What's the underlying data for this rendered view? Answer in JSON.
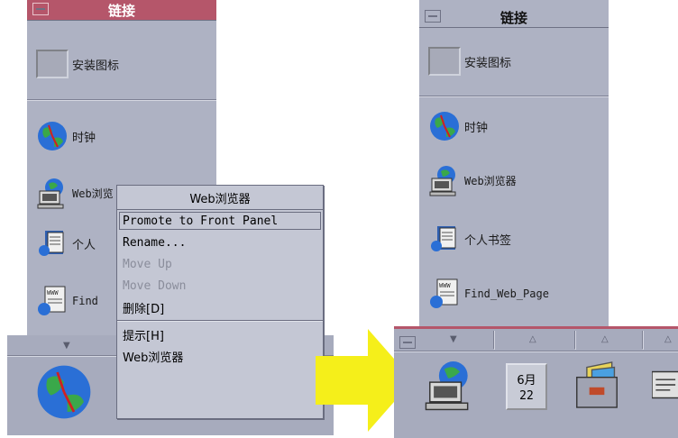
{
  "left": {
    "title": "链接",
    "items": [
      {
        "label": "安装图标",
        "icon": "install-icon-slot"
      },
      {
        "label": "时钟",
        "icon": "globe-clock-icon"
      },
      {
        "label": "Web浏览器",
        "icon": "web-browser-icon"
      },
      {
        "label": "个人书签",
        "icon": "bookmark-icon"
      },
      {
        "label": "Find_Web_Page",
        "icon": "find-web-page-icon"
      }
    ],
    "partial_labels": {
      "browser": "Web浏览",
      "bookmark": "个人",
      "find": "Find"
    }
  },
  "context_menu": {
    "title": "Web浏览器",
    "items": [
      {
        "label": "Promote to Front Panel",
        "enabled": true,
        "highlighted": true
      },
      {
        "label": "Rename...",
        "enabled": true
      },
      {
        "label": "Move Up",
        "enabled": false
      },
      {
        "label": "Move Down",
        "enabled": false
      },
      {
        "label": "删除[D]",
        "enabled": true
      },
      {
        "label": "提示[H]",
        "enabled": true
      },
      {
        "label": "Web浏览器",
        "enabled": true
      }
    ]
  },
  "right": {
    "title": "链接",
    "items": [
      {
        "label": "安装图标"
      },
      {
        "label": "时钟"
      },
      {
        "label": "Web浏览器"
      },
      {
        "label": "个人书签"
      },
      {
        "label": "Find_Web_Page"
      }
    ],
    "calendar": {
      "month": "6月",
      "day": "22"
    }
  },
  "colors": {
    "panel": "#aeb2c3",
    "title_left": "#b5566a",
    "arrow": "#f5ef1a"
  }
}
